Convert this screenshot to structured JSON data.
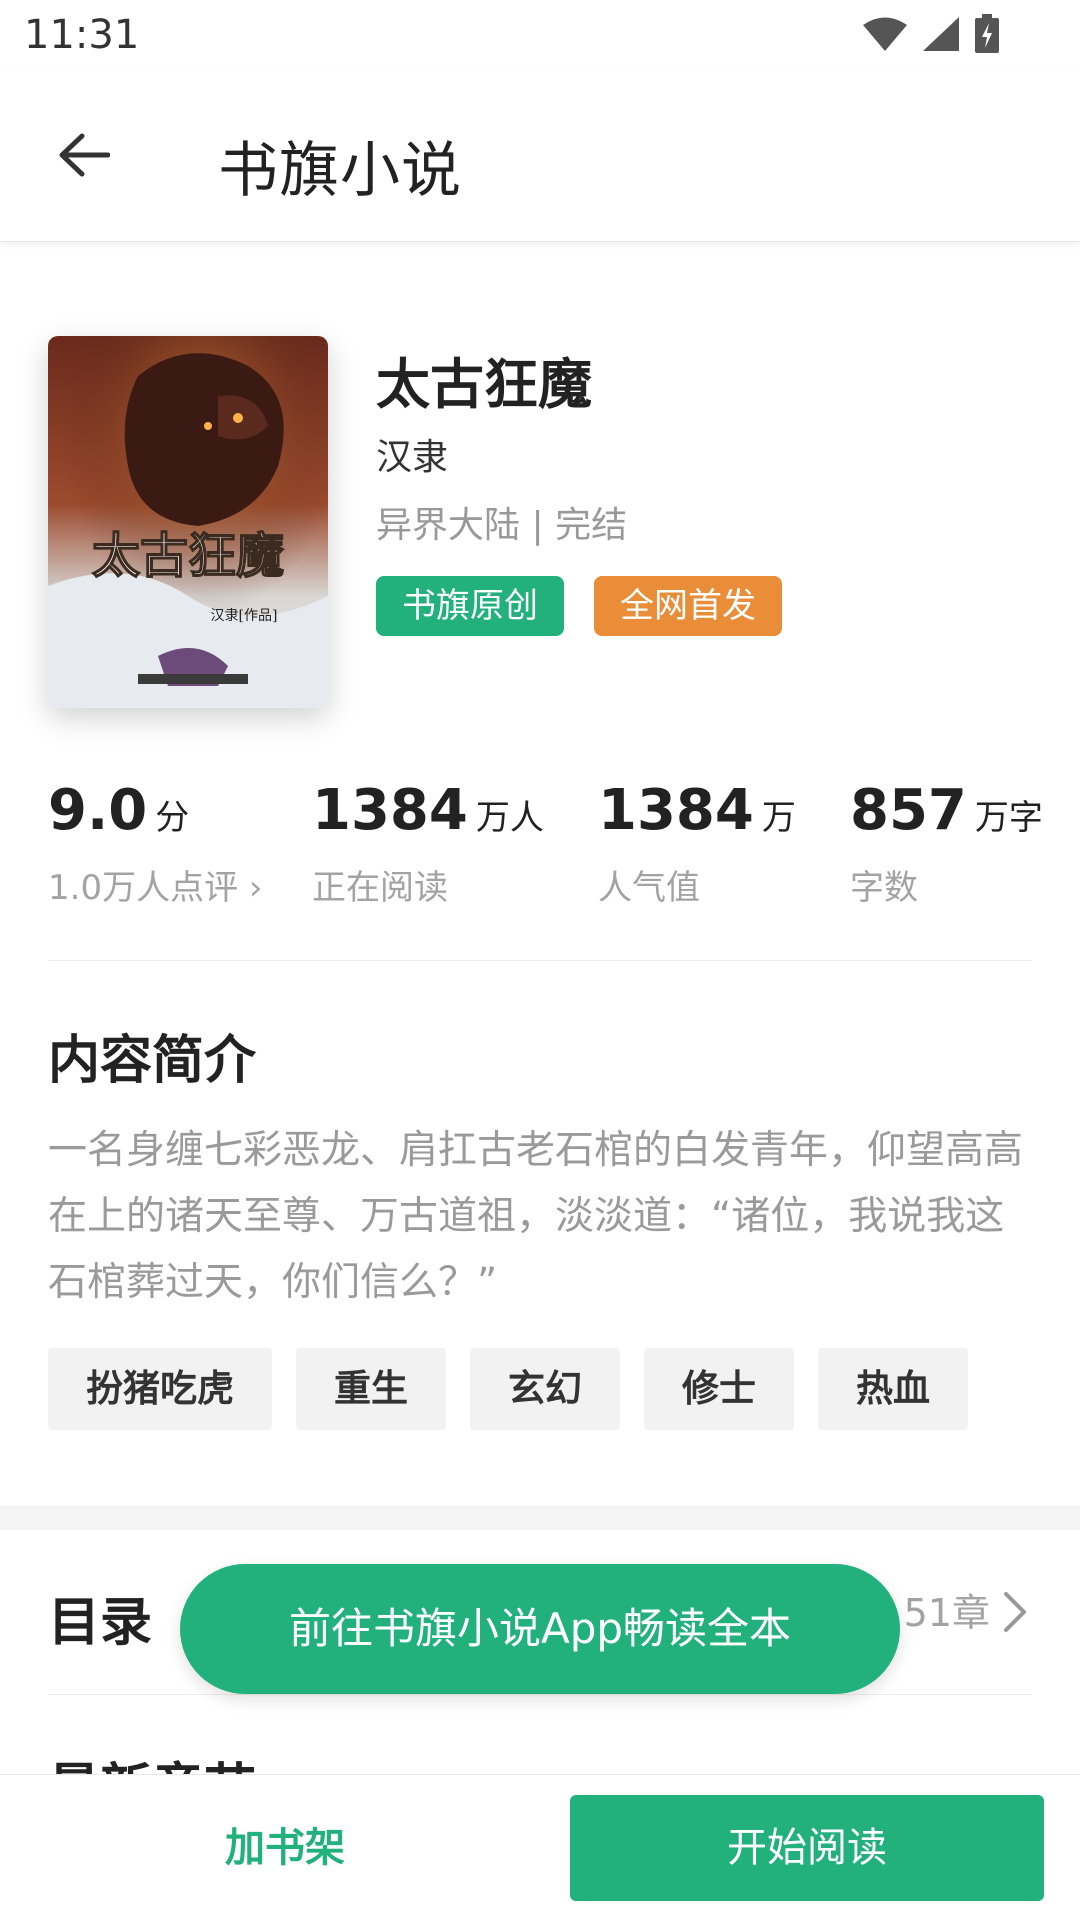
{
  "status_bar": {
    "time": "11:31",
    "icons": [
      "wifi-icon",
      "signal-icon",
      "battery-charging-icon"
    ]
  },
  "app_bar": {
    "title": "书旗小说",
    "back_icon": "arrow-left-icon"
  },
  "book": {
    "title": "太古狂魔",
    "author": "汉隶",
    "category": "异界大陆",
    "separator": "|",
    "status": "完结",
    "badges": [
      "书旗原创",
      "全网首发"
    ],
    "cover_title": "太古狂魔",
    "cover_credit": "汉隶[作品]"
  },
  "stats": [
    {
      "value": "9.0",
      "unit": "分",
      "label": "1.0万人点评 ›"
    },
    {
      "value": "1384",
      "unit": "万人",
      "label": "正在阅读"
    },
    {
      "value": "1384",
      "unit": "万",
      "label": "人气值"
    },
    {
      "value": "857",
      "unit": "万字",
      "label": "字数"
    }
  ],
  "intro": {
    "title": "内容简介",
    "text": "一名身缠七彩恶龙、肩扛古老石棺的白发青年，仰望高高在上的诸天至尊、万古道祖，淡淡道：“诸位，我说我这石棺葬过天，你们信么？”"
  },
  "tags": [
    "扮猪吃虎",
    "重生",
    "玄幻",
    "修士",
    "热血"
  ],
  "catalog": {
    "title": "目录",
    "count": "51章"
  },
  "latest": {
    "title": "最新章节"
  },
  "promo": {
    "label": "前往书旗小说App畅读全本"
  },
  "bottom_bar": {
    "add_shelf": "加书架",
    "start_read": "开始阅读"
  },
  "colors": {
    "accent": "#22b07d",
    "orange": "#e98d38",
    "muted": "#a3a3a3"
  }
}
